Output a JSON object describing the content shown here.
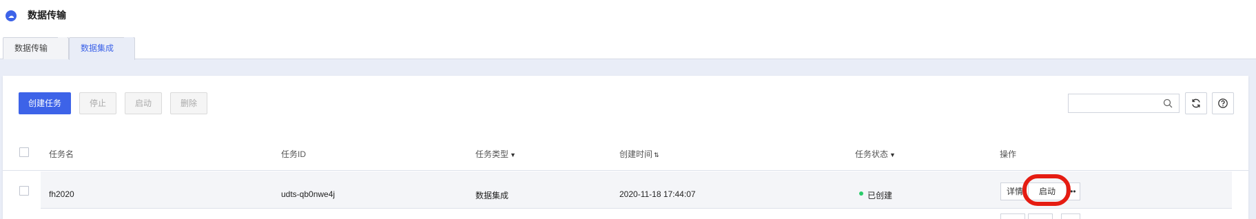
{
  "app": {
    "title": "数据传输",
    "logo_icon": "cloud-logo-icon"
  },
  "tabs": [
    {
      "label": "数据传输",
      "active": false
    },
    {
      "label": "数据集成",
      "active": true
    }
  ],
  "toolbar": {
    "create_label": "创建任务",
    "stop_label": "停止",
    "start_label": "启动",
    "delete_label": "删除",
    "search_placeholder": "",
    "search_value": ""
  },
  "table": {
    "columns": [
      "任务名",
      "任务ID",
      "任务类型",
      "创建时间",
      "任务状态",
      "操作"
    ],
    "rows": [
      {
        "name": "fh2020",
        "id": "udts-qb0nwe4j",
        "type": "数据集成",
        "created": "2020-11-18 17:44:07",
        "status": "已创建",
        "status_color": "#29cc6a",
        "actions": {
          "detail": "详情",
          "start": "启动",
          "more": "•••"
        }
      }
    ]
  },
  "colors": {
    "primary": "#3d63e8",
    "highlight": "#e51c12",
    "status_ok": "#29cc6a"
  }
}
